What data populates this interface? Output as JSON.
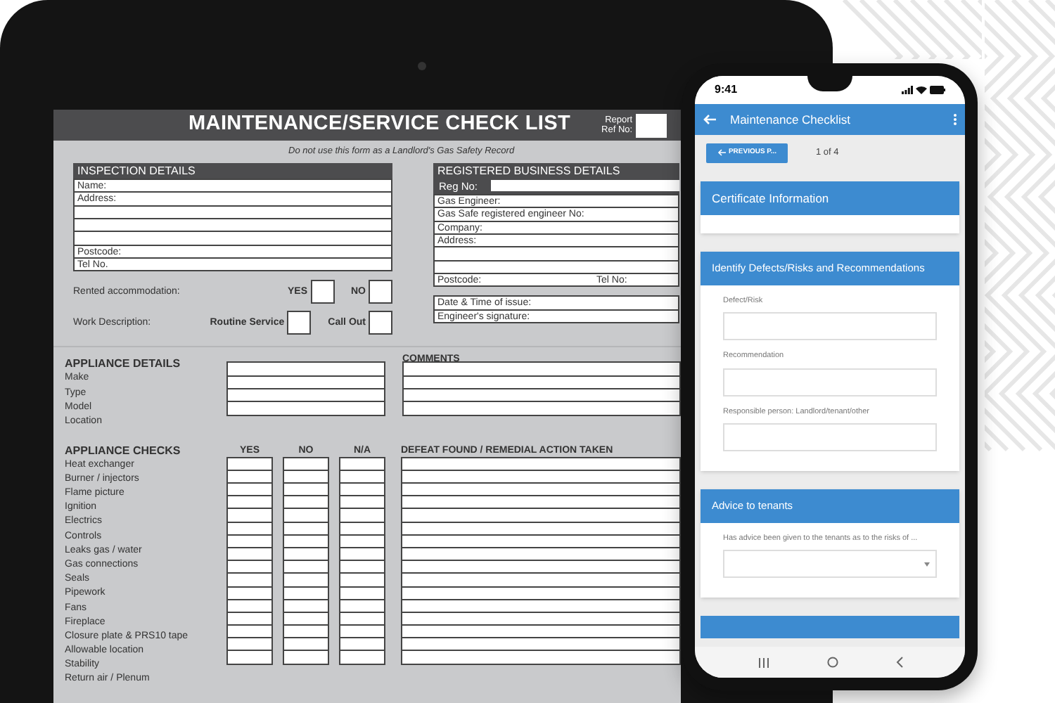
{
  "form": {
    "title": "MAINTENANCE/SERVICE CHECK LIST",
    "ref_label": "Report Ref No:",
    "notice": "Do not use this form as a Landlord's Gas Safety Record",
    "inspection": {
      "heading": "INSPECTION DETAILS",
      "lines": [
        {
          "kind": "label",
          "label": "Name:"
        },
        {
          "kind": "label",
          "label": "Address:"
        },
        {
          "kind": "blank"
        },
        {
          "kind": "blank"
        },
        {
          "kind": "blank"
        },
        {
          "kind": "label",
          "label": "Postcode:"
        },
        {
          "kind": "label",
          "label": "Tel No."
        }
      ]
    },
    "questions": [
      {
        "label": "Rented accommodation:",
        "options": [
          {
            "label": "YES",
            "checked": false
          },
          {
            "label": "NO",
            "checked": false
          }
        ]
      },
      {
        "label": "Work Description:",
        "options": [
          {
            "label": "Routine Service",
            "checked": false
          },
          {
            "label": "Call Out",
            "checked": false
          }
        ]
      }
    ],
    "business": {
      "heading": "REGISTERED BUSINESS DETAILS",
      "reg_label": "Reg No:",
      "lines": [
        {
          "kind": "label",
          "label": "Gas Engineer:"
        },
        {
          "kind": "label",
          "label": "Gas Safe registered engineer No:"
        },
        {
          "kind": "label",
          "label": "Company:"
        },
        {
          "kind": "label",
          "label": "Address:"
        },
        {
          "kind": "blank"
        },
        {
          "kind": "blank"
        },
        {
          "kind": "pair",
          "label": "Postcode:",
          "label_2": "Tel No:"
        }
      ],
      "issue_lines": [
        "Date & Time of issue:",
        "Engineer's signature:"
      ]
    },
    "appliance_details": {
      "heading": "APPLIANCE DETAILS",
      "comments_heading": "COMMENTS",
      "rows": [
        "Make",
        "Type",
        "Model",
        "Location"
      ]
    },
    "appliance_checks": {
      "heading": "APPLIANCE CHECKS",
      "columns": [
        "YES",
        "NO",
        "N/A"
      ],
      "action_heading": "DEFEAT FOUND / REMEDIAL ACTION TAKEN",
      "rows": [
        {
          "label": "Heat exchanger",
          "checks": [
            false,
            false,
            false
          ]
        },
        {
          "label": "Burner / injectors",
          "checks": [
            false,
            false,
            false
          ]
        },
        {
          "label": "Flame picture",
          "checks": [
            false,
            false,
            false
          ]
        },
        {
          "label": "Ignition",
          "checks": [
            false,
            false,
            false
          ]
        },
        {
          "label": "Electrics",
          "checks": [
            false,
            false,
            false
          ]
        },
        {
          "label": "Controls",
          "checks": [
            false,
            false,
            false
          ]
        },
        {
          "label": "Leaks gas / water",
          "checks": [
            false,
            false,
            false
          ]
        },
        {
          "label": "Gas connections",
          "checks": [
            false,
            false,
            false
          ]
        },
        {
          "label": "Seals",
          "checks": [
            false,
            false,
            false
          ]
        },
        {
          "label": "Pipework",
          "checks": [
            false,
            false,
            false
          ]
        },
        {
          "label": "Fans",
          "checks": [
            false,
            false,
            false
          ]
        },
        {
          "label": "Fireplace",
          "checks": [
            false,
            false,
            false
          ]
        },
        {
          "label": "Closure plate & PRS10 tape",
          "checks": [
            false,
            false,
            false
          ]
        },
        {
          "label": "Allowable location",
          "checks": [
            false,
            false,
            false
          ]
        },
        {
          "label": "Stability",
          "checks": [
            false,
            false,
            false
          ]
        },
        {
          "label": "Return air / Plenum",
          "checks": [
            false,
            false,
            false
          ]
        }
      ]
    }
  },
  "phone": {
    "time": "9:41",
    "title": "Maintenance Checklist",
    "prev_button": "PREVIOUS P...",
    "page": "1 of 4",
    "sections": [
      {
        "kind": "empty",
        "title": "Certificate Information"
      },
      {
        "kind": "fields",
        "title": "Identify Defects/Risks and Recommendations",
        "fields": [
          {
            "kind": "text",
            "label": "Defect/Risk"
          },
          {
            "kind": "text",
            "label": "Recommendation"
          },
          {
            "kind": "text",
            "label": "Responsible person: Landlord/tenant/other"
          }
        ]
      },
      {
        "kind": "fields",
        "title": "Advice to tenants",
        "fields": [
          {
            "kind": "select",
            "label": "Has advice been given to the tenants as to the risks of ..."
          }
        ]
      },
      {
        "kind": "cut"
      }
    ]
  }
}
